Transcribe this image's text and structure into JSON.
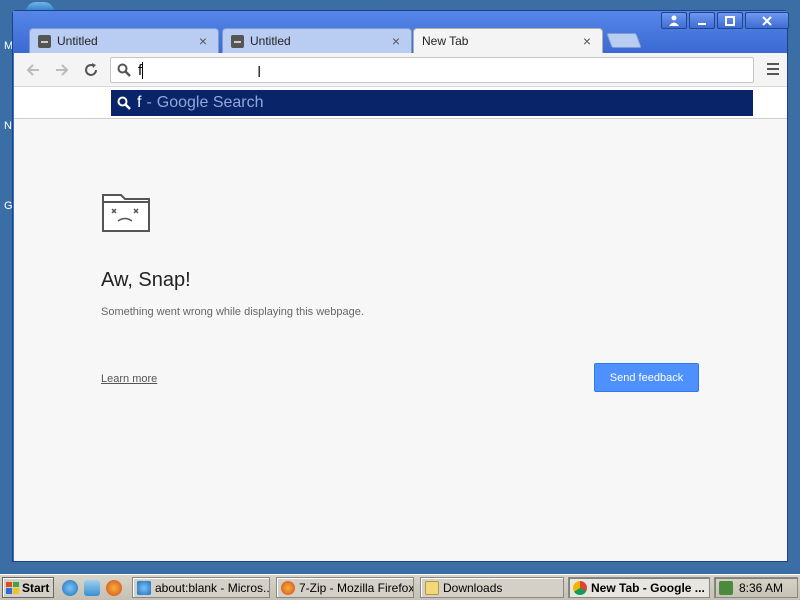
{
  "desktop": {
    "letters": [
      "M",
      "N",
      "G"
    ]
  },
  "window": {
    "controls": {
      "user_icon": "user-icon",
      "minimize_icon": "minimize-icon",
      "maximize_icon": "maximize-icon",
      "close_icon": "close-icon"
    }
  },
  "tabs": [
    {
      "label": "Untitled",
      "close": "×",
      "active": false
    },
    {
      "label": "Untitled",
      "close": "×",
      "active": false
    },
    {
      "label": "New Tab",
      "close": "×",
      "active": true
    }
  ],
  "omnibox": {
    "value": "f",
    "cursor_glyph": "I"
  },
  "suggestion": {
    "query": "f",
    "separator": "-",
    "engine": "Google Search"
  },
  "error_page": {
    "title": "Aw, Snap!",
    "message": "Something went wrong while displaying this webpage.",
    "learn_more": "Learn more",
    "feedback_button": "Send feedback"
  },
  "taskbar": {
    "start_label": "Start",
    "buttons": [
      {
        "label": "about:blank - Micros..."
      },
      {
        "label": "7-Zip - Mozilla Firefox"
      },
      {
        "label": "Downloads"
      },
      {
        "label": "New Tab - Google ..."
      }
    ],
    "clock": "8:36 AM"
  },
  "colors": {
    "suggestion_highlight": "#0a246a",
    "feedback_button": "#4d90fe",
    "title_bar": "#3f6fd0"
  }
}
